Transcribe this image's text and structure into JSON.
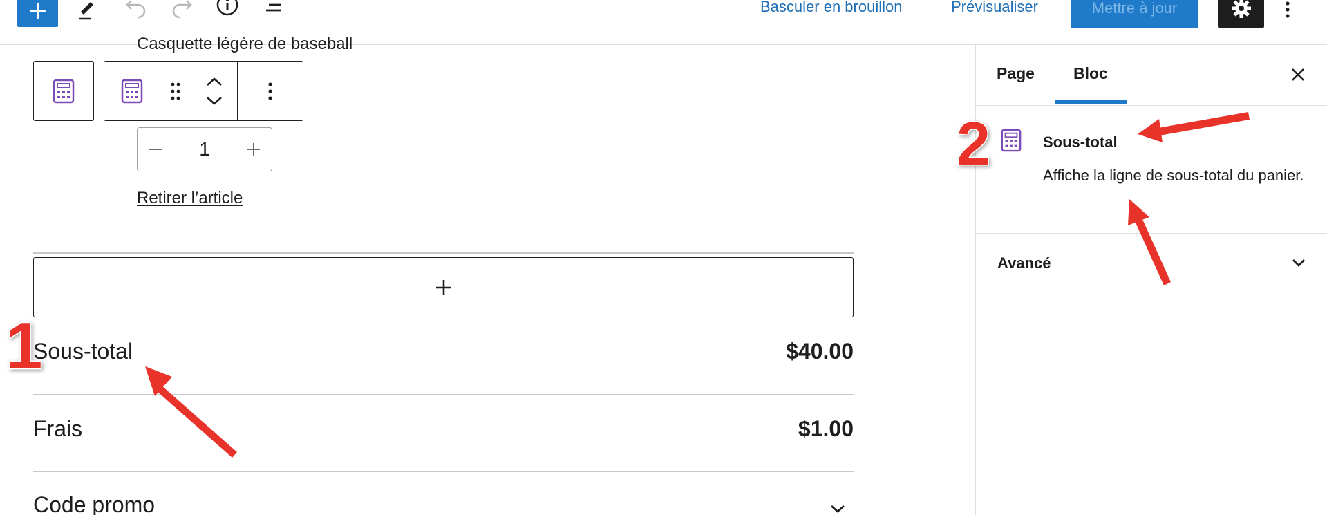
{
  "toolbar": {
    "draft_label": "Basculer en brouillon",
    "preview_label": "Prévisualiser",
    "update_label": "Mettre à jour",
    "icons": [
      "plus-icon",
      "pencil-icon",
      "undo-icon",
      "redo-icon",
      "info-icon",
      "list-view-icon",
      "gear-icon",
      "more-vertical-icon"
    ]
  },
  "canvas": {
    "product_name": "Casquette légère de baseball",
    "quantity": "1",
    "remove_label": "Retirer l’article",
    "totals": [
      {
        "label": "Sous-total",
        "value": "$40.00"
      },
      {
        "label": "Frais",
        "value": "$1.00"
      }
    ],
    "promo_label": "Code promo"
  },
  "sidebar": {
    "tabs": [
      {
        "label": "Page",
        "active": false
      },
      {
        "label": "Bloc",
        "active": true
      }
    ],
    "block": {
      "title": "Sous-total",
      "description": "Affiche la ligne de sous-total du panier."
    },
    "advanced_label": "Avancé"
  },
  "annotations": {
    "marker_1": "1",
    "marker_2": "2",
    "color": "#e8332b"
  },
  "colors": {
    "accent": "#1f7bc9",
    "link": "#1f6fb6",
    "block_icon": "#7b4bb7"
  }
}
